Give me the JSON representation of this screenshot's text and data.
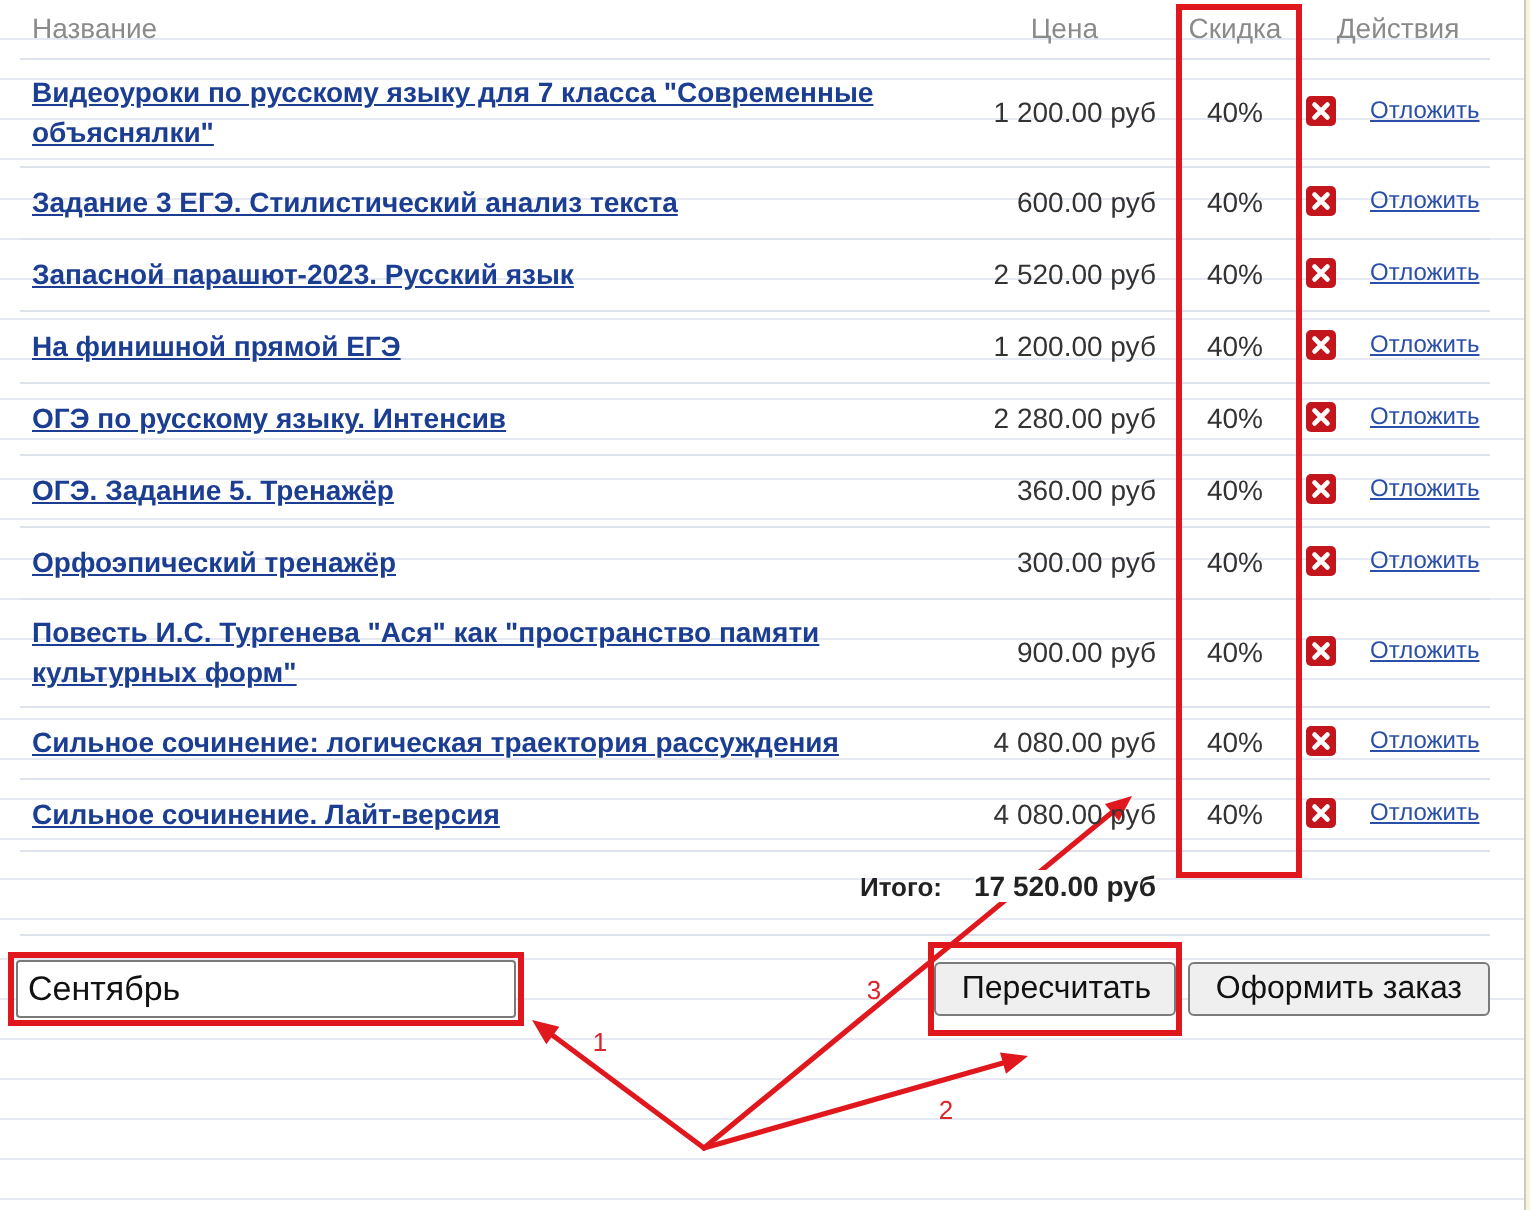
{
  "table": {
    "columns": [
      {
        "label": "Название",
        "highlighted": false
      },
      {
        "label": "Цена",
        "highlighted": false
      },
      {
        "label": "Скидка",
        "highlighted": true
      },
      {
        "label": "Действия",
        "highlighted": false
      }
    ],
    "rows": [
      {
        "name": "Видеоуроки по русскому языку для 7 класса \"Современные объяснялки\"",
        "price": "1 200.00 руб",
        "discount": "40%",
        "action": "Отложить"
      },
      {
        "name": "Задание 3 ЕГЭ. Стилистический анализ текста",
        "price": "600.00 руб",
        "discount": "40%",
        "action": "Отложить"
      },
      {
        "name": "Запасной парашют-2023. Русский язык",
        "price": "2 520.00 руб",
        "discount": "40%",
        "action": "Отложить"
      },
      {
        "name": "На финишной прямой ЕГЭ",
        "price": "1 200.00 руб",
        "discount": "40%",
        "action": "Отложить"
      },
      {
        "name": "ОГЭ по русскому языку. Интенсив",
        "price": "2 280.00 руб",
        "discount": "40%",
        "action": "Отложить"
      },
      {
        "name": "ОГЭ. Задание 5. Тренажёр",
        "price": "360.00 руб",
        "discount": "40%",
        "action": "Отложить"
      },
      {
        "name": "Орфоэпический тренажёр",
        "price": "300.00 руб",
        "discount": "40%",
        "action": "Отложить"
      },
      {
        "name": "Повесть И.С. Тургенева \"Ася\" как \"пространство памяти культурных форм\"",
        "price": "900.00 руб",
        "discount": "40%",
        "action": "Отложить"
      },
      {
        "name": "Сильное сочинение: логическая траектория рассуждения",
        "price": "4 080.00 руб",
        "discount": "40%",
        "action": "Отложить"
      },
      {
        "name": "Сильное сочинение. Лайт-версия",
        "price": "4 080.00 руб",
        "discount": "40%",
        "action": "Отложить"
      }
    ],
    "total": {
      "label": "Итого:",
      "value": "17 520.00 руб"
    }
  },
  "promo_field": {
    "value": "Сентябрь",
    "highlighted": true
  },
  "buttons": [
    {
      "label": "Пересчитать",
      "highlighted": true
    },
    {
      "label": "Оформить заказ",
      "highlighted": false
    }
  ],
  "annotations": [
    {
      "label": "1"
    },
    {
      "label": "2"
    },
    {
      "label": "3"
    }
  ]
}
